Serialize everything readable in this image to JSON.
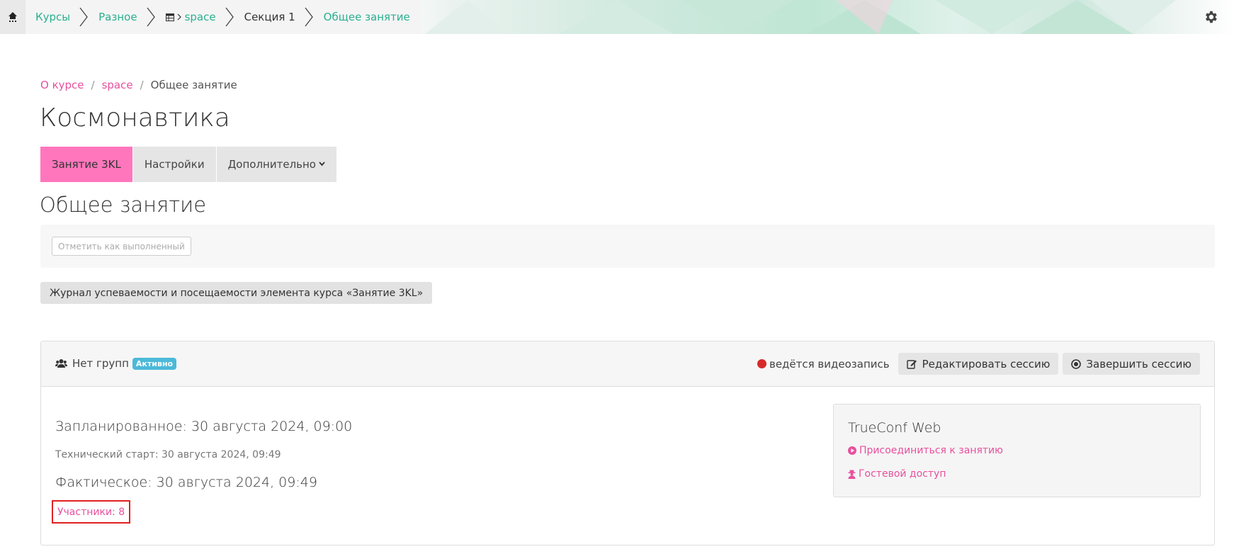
{
  "nav": {
    "crumbs": [
      {
        "label": "Курсы"
      },
      {
        "label": "Разное"
      },
      {
        "label": "space"
      },
      {
        "label": "Секция 1"
      },
      {
        "label": "Общее занятие"
      }
    ]
  },
  "breadcrumb": {
    "items": [
      "О курсе",
      "space",
      "Общее занятие"
    ],
    "separator": "/"
  },
  "page": {
    "title": "Космонавтика",
    "subtitle": "Общее занятие"
  },
  "tabs": {
    "items": [
      {
        "label": "Занятие 3KL",
        "active": true
      },
      {
        "label": "Настройки"
      },
      {
        "label": "Дополнительно"
      }
    ]
  },
  "completion": {
    "button_label": "Отметить как выполненный"
  },
  "journal": {
    "button_label": "Журнал успеваемости и посещаемости элемента курса «Занятие 3KL»"
  },
  "session": {
    "groups_label": "Нет групп",
    "status_badge": "Активно",
    "recording_label": "ведётся видеозапись",
    "edit_button": "Редактировать сессию",
    "end_button": "Завершить сессию",
    "planned": "Запланированное: 30 августа 2024, 09:00",
    "technical_start": "Технический старт: 30 августа 2024, 09:49",
    "actual": "Фактическое: 30 августа 2024, 09:49",
    "participants": "Участники: 8"
  },
  "trueconf": {
    "title": "TrueConf Web",
    "join_link": "Присоединиться к занятию",
    "guest_link": "Гостевой доступ"
  },
  "colors": {
    "accent_green": "#2ab090",
    "accent_pink": "#e8509e",
    "active_tab": "#ff76bd",
    "badge": "#4cb9d9",
    "record": "#d62a2a"
  }
}
